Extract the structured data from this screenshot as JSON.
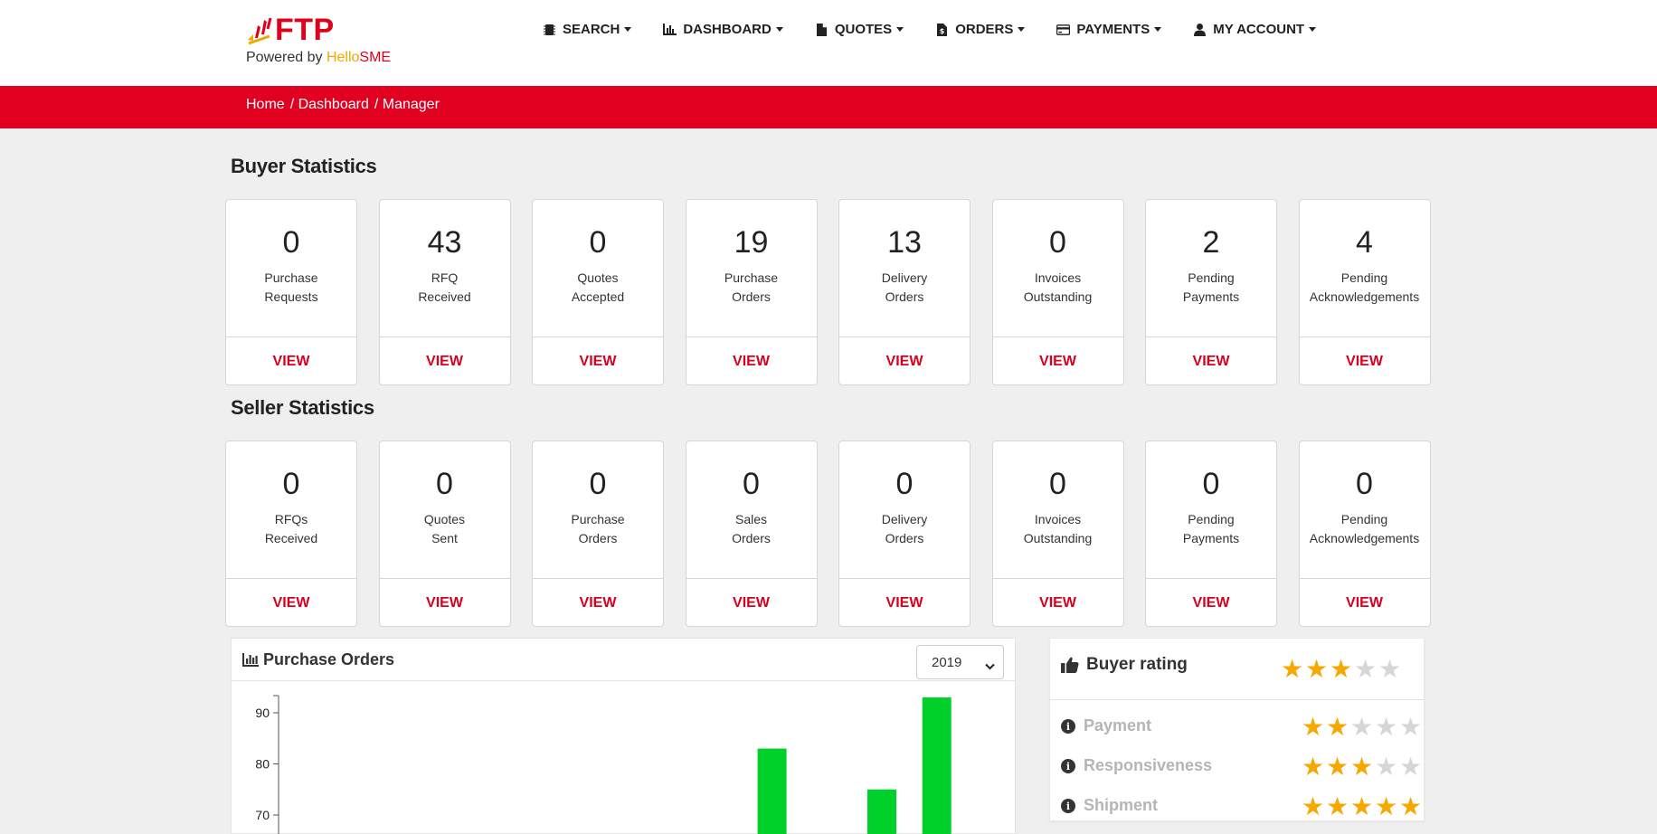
{
  "brand": {
    "name": "FTP",
    "powered_prefix": "Powered by ",
    "powered_hello": "Hello",
    "powered_sme": "SME"
  },
  "nav": [
    {
      "label": "SEARCH",
      "icon": "chip-icon"
    },
    {
      "label": "DASHBOARD",
      "icon": "chart-icon"
    },
    {
      "label": "QUOTES",
      "icon": "file-icon"
    },
    {
      "label": "ORDERS",
      "icon": "file-invoice-icon"
    },
    {
      "label": "PAYMENTS",
      "icon": "credit-card-icon"
    },
    {
      "label": "MY ACCOUNT",
      "icon": "user-icon"
    }
  ],
  "breadcrumb": [
    "Home",
    "/ Dashboard",
    "/ Manager"
  ],
  "buyer": {
    "title": "Buyer Statistics",
    "cards": [
      {
        "value": "0",
        "line1": "Purchase",
        "line2": "Requests",
        "action": "VIEW"
      },
      {
        "value": "43",
        "line1": "RFQ",
        "line2": "Received",
        "action": "VIEW"
      },
      {
        "value": "0",
        "line1": "Quotes",
        "line2": "Accepted",
        "action": "VIEW"
      },
      {
        "value": "19",
        "line1": "Purchase",
        "line2": "Orders",
        "action": "VIEW"
      },
      {
        "value": "13",
        "line1": "Delivery",
        "line2": "Orders",
        "action": "VIEW"
      },
      {
        "value": "0",
        "line1": "Invoices",
        "line2": "Outstanding",
        "action": "VIEW"
      },
      {
        "value": "2",
        "line1": "Pending",
        "line2": "Payments",
        "action": "VIEW"
      },
      {
        "value": "4",
        "line1": "Pending",
        "line2": "Acknowledgements",
        "action": "VIEW"
      }
    ]
  },
  "seller": {
    "title": "Seller Statistics",
    "cards": [
      {
        "value": "0",
        "line1": "RFQs",
        "line2": "Received",
        "action": "VIEW"
      },
      {
        "value": "0",
        "line1": "Quotes",
        "line2": "Sent",
        "action": "VIEW"
      },
      {
        "value": "0",
        "line1": "Purchase",
        "line2": "Orders",
        "action": "VIEW"
      },
      {
        "value": "0",
        "line1": "Sales",
        "line2": "Orders",
        "action": "VIEW"
      },
      {
        "value": "0",
        "line1": "Delivery",
        "line2": "Orders",
        "action": "VIEW"
      },
      {
        "value": "0",
        "line1": "Invoices",
        "line2": "Outstanding",
        "action": "VIEW"
      },
      {
        "value": "0",
        "line1": "Pending",
        "line2": "Payments",
        "action": "VIEW"
      },
      {
        "value": "0",
        "line1": "Pending",
        "line2": "Acknowledgements",
        "action": "VIEW"
      }
    ]
  },
  "purchase_orders": {
    "title": "Purchase Orders",
    "year": "2019"
  },
  "chart_data": {
    "type": "bar",
    "title": "",
    "xlabel": "",
    "ylabel": "",
    "yticks": [
      70,
      80,
      90
    ],
    "ylim_visible": [
      66,
      93
    ],
    "bar_color": "#00d02a",
    "bars": [
      {
        "slot": 8,
        "value": 83
      },
      {
        "slot": 10,
        "value": 75
      },
      {
        "slot": 11,
        "value": 93
      }
    ]
  },
  "rating": {
    "title": "Buyer rating",
    "overall": 3,
    "max": 5,
    "rows": [
      {
        "name": "Payment",
        "stars": 2
      },
      {
        "name": "Responsiveness",
        "stars": 3
      },
      {
        "name": "Shipment",
        "stars": 5
      }
    ],
    "star_on_color": "#f5a800",
    "star_off_color": "#d6d6d6"
  },
  "colors": {
    "brand_red": "#e10020",
    "view_red": "#d8001e",
    "page_bg": "#efefef"
  }
}
